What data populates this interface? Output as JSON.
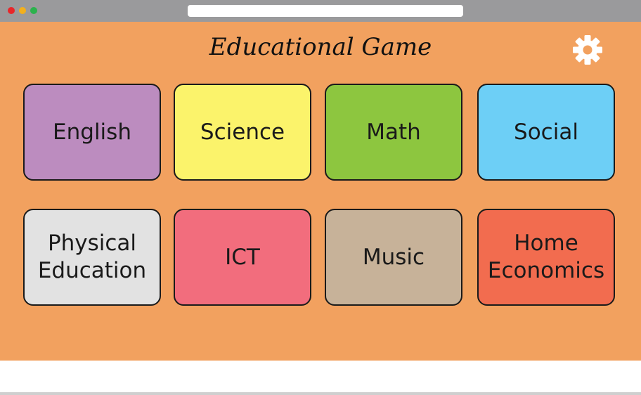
{
  "window": {
    "title_bar_color": "#9a9a9c",
    "controls": [
      "close-dot",
      "minimize-dot",
      "maximize-dot"
    ]
  },
  "app": {
    "title": "Educational Game",
    "background_color": "#f2a15f",
    "settings_icon": "gear-icon"
  },
  "subjects": [
    {
      "label": "English",
      "color": "#bc8cbf"
    },
    {
      "label": "Science",
      "color": "#fbf36b"
    },
    {
      "label": "Math",
      "color": "#8dc63f"
    },
    {
      "label": "Social",
      "color": "#6dcff6"
    },
    {
      "label": "Physical\nEducation",
      "color": "#e2e2e2"
    },
    {
      "label": "ICT",
      "color": "#f26d7d"
    },
    {
      "label": "Music",
      "color": "#c7b299"
    },
    {
      "label": "Home\nEconomics",
      "color": "#f26c4f"
    }
  ]
}
